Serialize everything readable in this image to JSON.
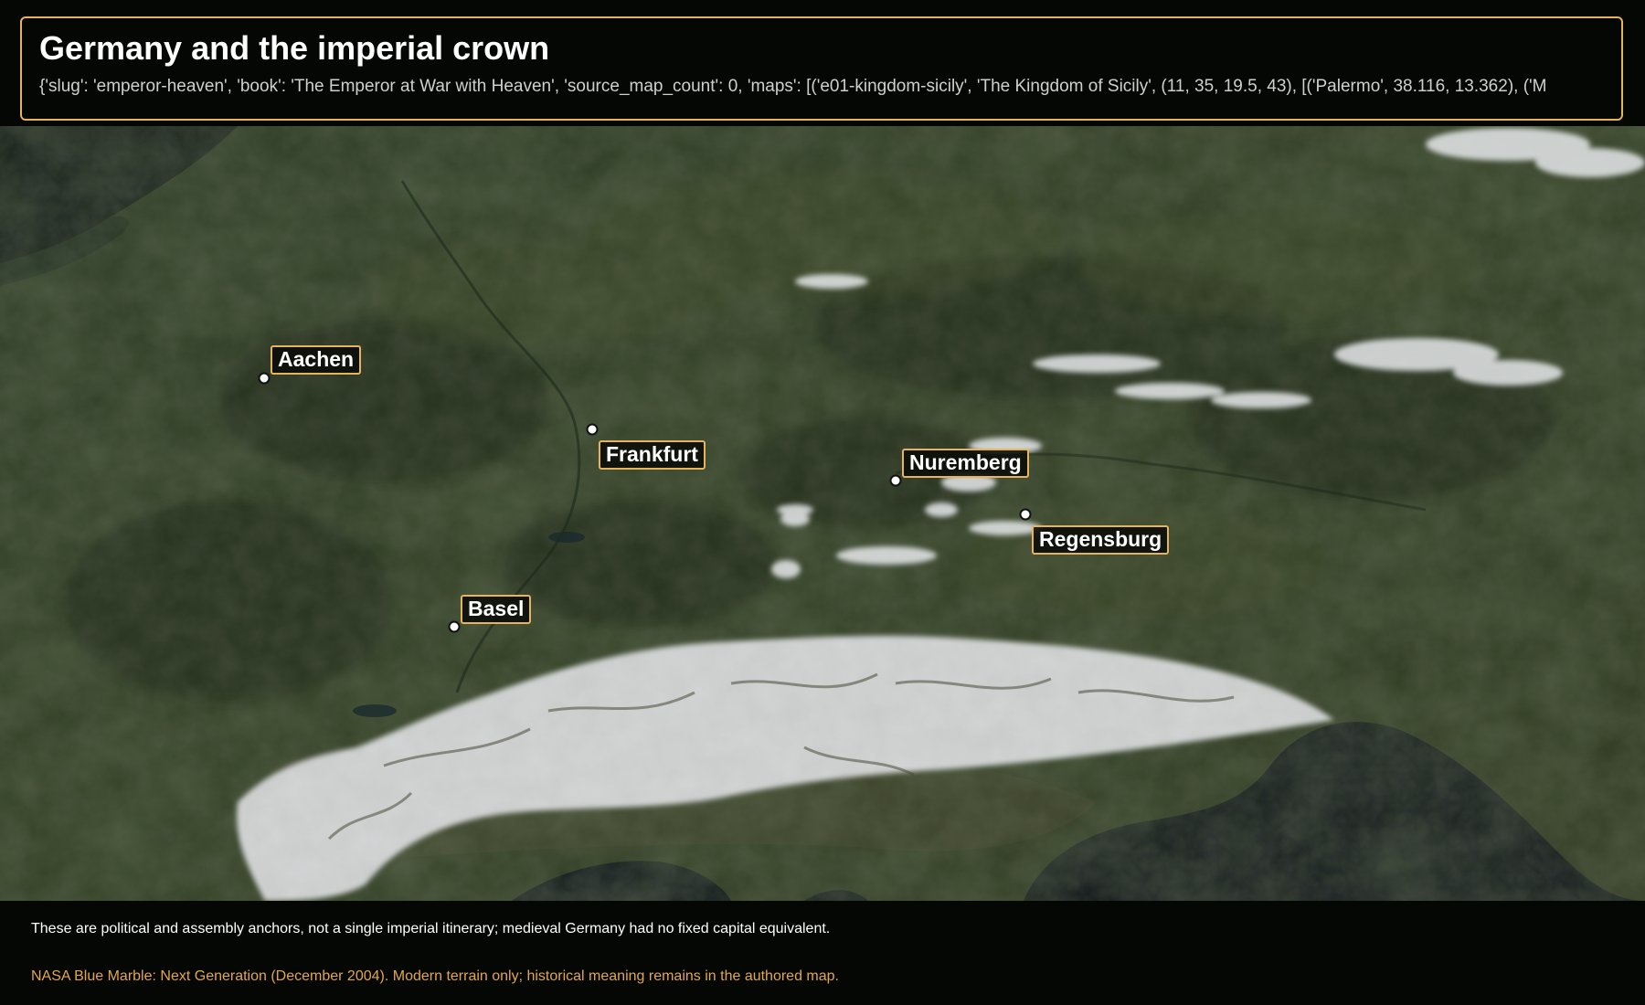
{
  "header": {
    "title": "Germany and the imperial crown",
    "subtitle": "{'slug': 'emperor-heaven', 'book': 'The Emperor at War with Heaven', 'source_map_count': 0, 'maps': [('e01-kingdom-sicily', 'The Kingdom of Sicily', (11, 35, 19.5, 43), [('Palermo', 38.116, 13.362), ('M"
  },
  "map": {
    "description_colors": {
      "land": "#2c3a1e",
      "snow": "#e8eaec",
      "sea": "#0a0f14",
      "label_border": "#e8b45a"
    },
    "places": [
      {
        "name": "Aachen"
      },
      {
        "name": "Frankfurt"
      },
      {
        "name": "Nuremberg"
      },
      {
        "name": "Regensburg"
      },
      {
        "name": "Basel"
      }
    ]
  },
  "footer": {
    "note": "These are political and assembly anchors, not a single imperial itinerary; medieval Germany had no fixed capital equivalent.",
    "credit": "NASA Blue Marble: Next Generation (December 2004). Modern terrain only; historical meaning remains in the authored map."
  }
}
